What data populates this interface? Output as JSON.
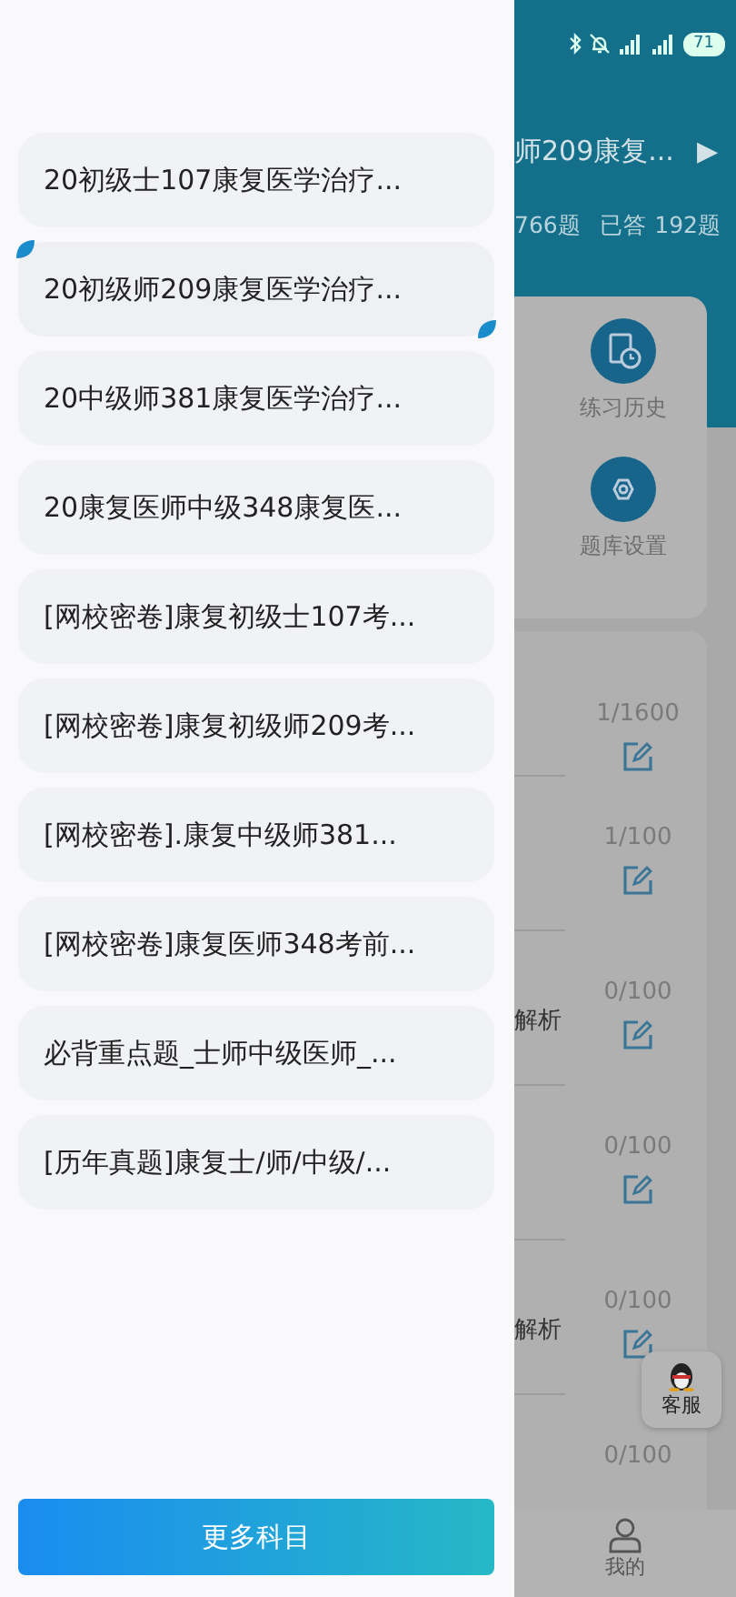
{
  "status_bar": {
    "battery": "71"
  },
  "drawer": {
    "subjects": [
      {
        "label": "20初级士107康复医学治疗...",
        "selected": false
      },
      {
        "label": "20初级师209康复医学治疗...",
        "selected": true
      },
      {
        "label": "20中级师381康复医学治疗...",
        "selected": false
      },
      {
        "label": "20康复医师中级348康复医...",
        "selected": false
      },
      {
        "label": "[网校密卷]康复初级士107考...",
        "selected": false
      },
      {
        "label": "[网校密卷]康复初级师209考...",
        "selected": false
      },
      {
        "label": "[网校密卷].康复中级师381...",
        "selected": false
      },
      {
        "label": "[网校密卷]康复医师348考前...",
        "selected": false
      },
      {
        "label": "必背重点题_士师中级医师_...",
        "selected": false
      },
      {
        "label": "[历年真题]康复士/师/中级/...",
        "selected": false
      }
    ],
    "more_button": "更多科目"
  },
  "background": {
    "title": "师209康复...",
    "arrow": "▶",
    "total": "766题",
    "answered": "已答 192题",
    "tools": [
      {
        "label": "练习历史",
        "kind": "history"
      },
      {
        "label": "题库设置",
        "kind": "settings"
      }
    ],
    "rows": [
      {
        "kind": "editable",
        "count": "1/1600"
      },
      {
        "kind": "editable",
        "count": "1/100"
      },
      {
        "kind": "editable",
        "text": "解析",
        "count": "0/100"
      },
      {
        "kind": "editable",
        "count": "0/100"
      },
      {
        "kind": "editable",
        "text": "解析",
        "count": "0/100"
      },
      {
        "kind": "partial",
        "count": "0/100"
      }
    ],
    "service_button": "客服",
    "nav": [
      {
        "label": "我的"
      }
    ]
  }
}
